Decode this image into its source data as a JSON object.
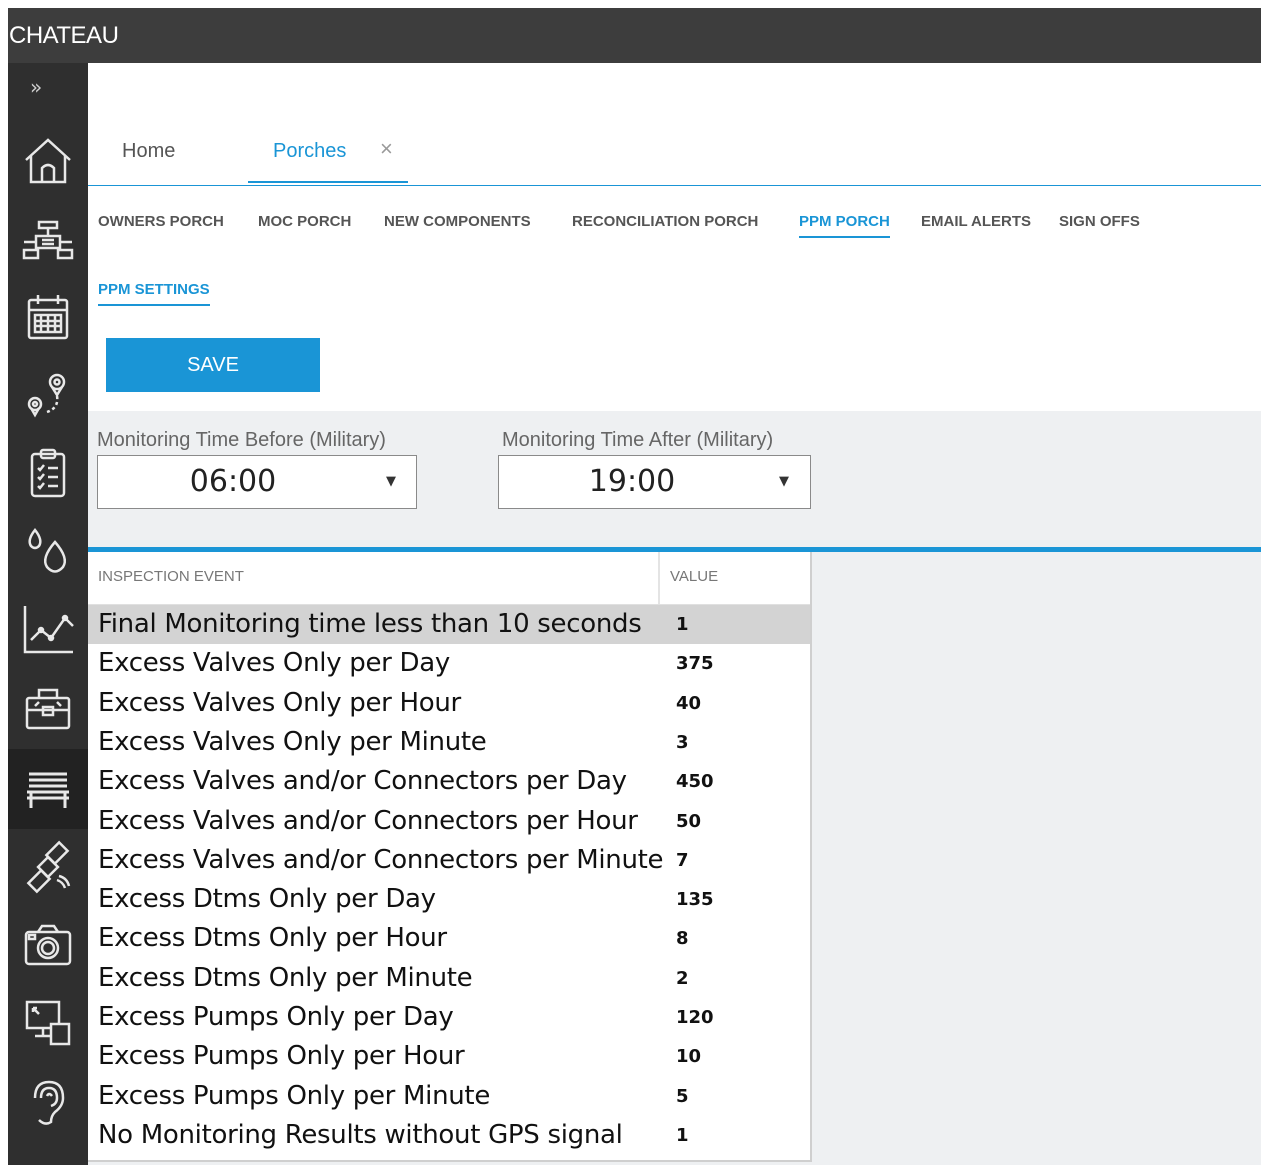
{
  "app": {
    "title": "CHATEAU"
  },
  "sidebar": {
    "expand_glyph": "»",
    "items": [
      {
        "icon": "home-icon"
      },
      {
        "icon": "valve-icon"
      },
      {
        "icon": "calendar-icon"
      },
      {
        "icon": "route-icon"
      },
      {
        "icon": "clipboard-icon"
      },
      {
        "icon": "drops-icon"
      },
      {
        "icon": "chart-icon"
      },
      {
        "icon": "toolbox-icon"
      },
      {
        "icon": "bench-icon",
        "active": true
      },
      {
        "icon": "satellite-icon"
      },
      {
        "icon": "camera-icon"
      },
      {
        "icon": "screens-icon"
      },
      {
        "icon": "ear-icon"
      }
    ]
  },
  "tabs": {
    "home": "Home",
    "porches": "Porches",
    "close": "×"
  },
  "subnav": [
    "OWNERS PORCH",
    "MOC PORCH",
    "NEW COMPONENTS",
    "RECONCILIATION PORCH",
    "PPM PORCH",
    "EMAIL ALERTS",
    "SIGN OFFS"
  ],
  "subnav_active": "PPM PORCH",
  "subsub": "PPM SETTINGS",
  "save_label": "SAVE",
  "monitoring": {
    "before_label": "Monitoring Time Before (Military)",
    "before_value": "06:00",
    "after_label": "Monitoring Time After (Military)",
    "after_value": "19:00",
    "caret": "▼"
  },
  "grid": {
    "headers": [
      "INSPECTION EVENT",
      "VALUE"
    ],
    "rows": [
      {
        "event": "Final Monitoring time less than 10 seconds",
        "value": "1"
      },
      {
        "event": "Excess Valves Only per Day",
        "value": "375"
      },
      {
        "event": "Excess Valves Only per Hour",
        "value": "40"
      },
      {
        "event": "Excess Valves Only per Minute",
        "value": "3"
      },
      {
        "event": "Excess Valves and/or Connectors per Day",
        "value": "450"
      },
      {
        "event": "Excess Valves and/or Connectors per Hour",
        "value": "50"
      },
      {
        "event": "Excess Valves and/or Connectors per Minute",
        "value": "7"
      },
      {
        "event": "Excess Dtms Only per Day",
        "value": "135"
      },
      {
        "event": "Excess Dtms Only per Hour",
        "value": "8"
      },
      {
        "event": "Excess Dtms Only per Minute",
        "value": "2"
      },
      {
        "event": "Excess Pumps Only per Day",
        "value": "120"
      },
      {
        "event": "Excess Pumps Only per Hour",
        "value": "10"
      },
      {
        "event": "Excess Pumps Only per Minute",
        "value": "5"
      },
      {
        "event": "No Monitoring Results without GPS signal",
        "value": "1"
      }
    ]
  },
  "colors": {
    "accent": "#1a95d6",
    "titlebar": "#3d3d3d",
    "sidebar": "#2f2f2f",
    "selected_row": "#d3d3d3",
    "panel": "#eef0f2"
  }
}
